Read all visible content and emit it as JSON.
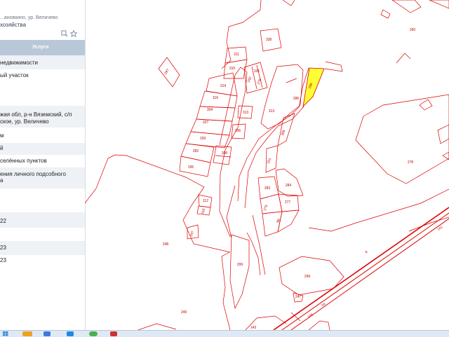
{
  "sidebar": {
    "address_line": "...ановкино, ур. Величево",
    "title": "хозяйства",
    "tab_header": "Услуги",
    "rows": [
      "недвижимости",
      "ый участок",
      "жая обл, р-н Вяземский, с/п",
      "ское, ур. Величево",
      "м",
      "й",
      "селённых пунктов",
      "ения личного подсобного",
      "а",
      "22",
      "23",
      "23"
    ]
  },
  "map": {
    "selected_parcel": "287",
    "highlight_color": "#ffff33",
    "boundary_color": "#dd0000",
    "parcel_labels": [
      "338",
      "260",
      "311",
      "310",
      "101",
      "242",
      "276",
      "297",
      "314",
      "286",
      "288",
      "313",
      "116",
      "313",
      "304",
      "327",
      "308",
      "159",
      "306",
      "282",
      "251",
      "309",
      "295",
      "278",
      "284",
      "283",
      "277",
      "279",
      "99",
      "112",
      "110",
      "247",
      "248",
      "299",
      "299",
      "247",
      "249",
      "143",
      "149",
      "54",
      "8",
      "141"
    ]
  },
  "taskbar": {
    "icons": [
      "windows-start-icon",
      "app-icon-1",
      "app-icon-2",
      "app-icon-3",
      "app-icon-4",
      "app-icon-5"
    ]
  }
}
